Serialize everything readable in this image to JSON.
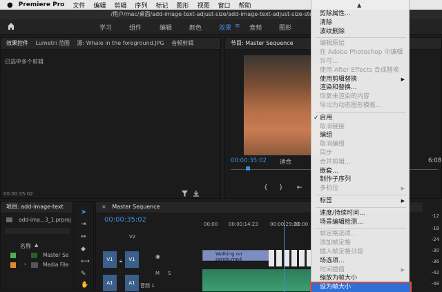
{
  "menubar": {
    "apple": "",
    "app_name": "Premiere Pro",
    "items": [
      "文件",
      "编辑",
      "剪辑",
      "序列",
      "标记",
      "图形",
      "视图",
      "窗口",
      "帮助"
    ]
  },
  "titlebar": {
    "path": "/用户/mac/桌面/add-image-text-adjust-size/add-image-text-adjust-size-step3_1.p"
  },
  "workspaces": {
    "tabs": [
      "学习",
      "组件",
      "编辑",
      "颜色",
      "效果",
      "音频",
      "图形"
    ],
    "active": "效果"
  },
  "effects_panel": {
    "tabs": [
      "效果控件",
      "Lumetri 范围",
      "源: Whale in the foreground.JPG",
      "音频剪辑"
    ],
    "message": "已选中多个剪辑",
    "timecode": "00:00:35:02"
  },
  "program_monitor": {
    "title": "节目: Master Sequence",
    "timecode": "00:00:35:02",
    "fit": "适合",
    "end_timecode": "6:08"
  },
  "project_panel": {
    "title": "项目: add-image-text",
    "file": "add-ima...3_1.prproj",
    "column": "名称",
    "items": [
      "Master Se",
      "Media File"
    ]
  },
  "timeline": {
    "title": "Master Sequence",
    "timecode": "00:00:35:02",
    "ruler": [
      "00:00",
      "00:00:14:23",
      "00:00:29:23",
      "00:00"
    ],
    "tracks": {
      "v2": "V2",
      "v1_src": "V1",
      "v1": "V1",
      "a1_src": "A1",
      "a1": "A1",
      "audio_label": "音频 1"
    },
    "clip_video": "Walking on sands.mp4",
    "meter": [
      "-12",
      "-18",
      "-24",
      "-30",
      "-36",
      "-42",
      "-48"
    ]
  },
  "context_menu": {
    "top_arrow": "▲",
    "groups": [
      [
        {
          "label": "剪除属性...",
          "enabled": true
        },
        {
          "label": "清除",
          "enabled": true
        },
        {
          "label": "波纹删除",
          "enabled": true
        }
      ],
      [
        {
          "label": "编辑原始",
          "enabled": false
        },
        {
          "label": "在 Adobe Photoshop 中编辑",
          "enabled": false
        },
        {
          "label": "许可...",
          "enabled": false
        },
        {
          "label": "使用 After Effects 合成替换",
          "enabled": false
        },
        {
          "label": "使用剪辑替换",
          "enabled": true,
          "submenu": true
        },
        {
          "label": "渲染和替换...",
          "enabled": true
        },
        {
          "label": "恢复未渲染的内容",
          "enabled": false
        },
        {
          "label": "导出为动态图形模板...",
          "enabled": false
        }
      ],
      [
        {
          "label": "启用",
          "enabled": true,
          "checked": true
        },
        {
          "label": "取消链接",
          "enabled": false
        },
        {
          "label": "编组",
          "enabled": true
        },
        {
          "label": "取消编组",
          "enabled": false
        },
        {
          "label": "同步",
          "enabled": false
        },
        {
          "label": "合并剪辑...",
          "enabled": false
        },
        {
          "label": "嵌套...",
          "enabled": true
        },
        {
          "label": "制作子序列",
          "enabled": true
        },
        {
          "label": "多机位",
          "enabled": false,
          "submenu": true
        }
      ],
      [
        {
          "label": "标签",
          "enabled": true,
          "submenu": true
        }
      ],
      [
        {
          "label": "速度/持续时间...",
          "enabled": true
        },
        {
          "label": "场景编辑检测...",
          "enabled": true
        }
      ],
      [
        {
          "label": "帧定格选项...",
          "enabled": false
        },
        {
          "label": "添加帧定格",
          "enabled": false
        },
        {
          "label": "插入帧定格分段",
          "enabled": false
        },
        {
          "label": "场选项...",
          "enabled": true
        },
        {
          "label": "时间插值",
          "enabled": false,
          "submenu": true
        },
        {
          "label": "缩放为帧大小",
          "enabled": true
        },
        {
          "label": "设为帧大小",
          "enabled": true,
          "highlighted": true
        }
      ]
    ]
  },
  "colors": {
    "accent": "#3f8ae0",
    "highlight": "#2f6fd6",
    "highlight_border": "#e2492d"
  }
}
